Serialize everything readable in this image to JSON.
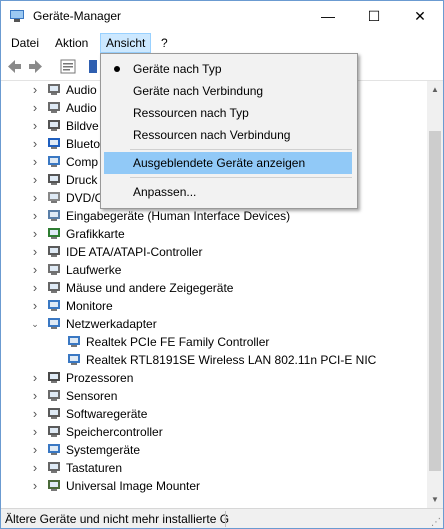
{
  "window": {
    "title": "Geräte-Manager",
    "controls": [
      "—",
      "☐",
      "✕"
    ]
  },
  "menubar": {
    "items": [
      "Datei",
      "Aktion",
      "Ansicht",
      "?"
    ],
    "open_index": 2
  },
  "dropdown": {
    "items": [
      {
        "label": "Geräte nach Typ",
        "checked": true
      },
      {
        "label": "Geräte nach Verbindung"
      },
      {
        "label": "Ressourcen nach Typ"
      },
      {
        "label": "Ressourcen nach Verbindung"
      },
      {
        "label": "Ausgeblendete Geräte anzeigen",
        "highlighted": true
      },
      {
        "label": "Anpassen..."
      }
    ]
  },
  "tree": {
    "nodes": [
      {
        "label": "Audio",
        "expanded": false,
        "icon": "speaker-icon"
      },
      {
        "label": "Audio",
        "expanded": false,
        "icon": "speaker-icon"
      },
      {
        "label": "Bildve",
        "expanded": false,
        "icon": "camera-icon"
      },
      {
        "label": "Blueto",
        "expanded": false,
        "icon": "bluetooth-icon"
      },
      {
        "label": "Comp",
        "expanded": false,
        "icon": "computer-icon"
      },
      {
        "label": "Druck",
        "expanded": false,
        "icon": "printer-icon"
      },
      {
        "label": "DVD/C",
        "expanded": false,
        "icon": "disc-drive-icon"
      },
      {
        "label": "Eingabegeräte (Human Interface Devices)",
        "expanded": false,
        "icon": "hid-icon"
      },
      {
        "label": "Grafikkarte",
        "expanded": false,
        "icon": "display-adapter-icon"
      },
      {
        "label": "IDE ATA/ATAPI-Controller",
        "expanded": false,
        "icon": "ide-controller-icon"
      },
      {
        "label": "Laufwerke",
        "expanded": false,
        "icon": "disk-drive-icon"
      },
      {
        "label": "Mäuse und andere Zeigegeräte",
        "expanded": false,
        "icon": "mouse-icon"
      },
      {
        "label": "Monitore",
        "expanded": false,
        "icon": "monitor-icon"
      },
      {
        "label": "Netzwerkadapter",
        "expanded": true,
        "icon": "network-icon"
      },
      {
        "label": "Realtek PCIe FE Family Controller",
        "child": true,
        "icon": "network-card-icon"
      },
      {
        "label": "Realtek RTL8191SE Wireless LAN 802.11n PCI-E NIC",
        "child": true,
        "icon": "network-card-icon"
      },
      {
        "label": "Prozessoren",
        "expanded": false,
        "icon": "processor-icon"
      },
      {
        "label": "Sensoren",
        "expanded": false,
        "icon": "sensor-icon"
      },
      {
        "label": "Softwaregeräte",
        "expanded": false,
        "icon": "software-device-icon"
      },
      {
        "label": "Speichercontroller",
        "expanded": false,
        "icon": "storage-controller-icon"
      },
      {
        "label": "Systemgeräte",
        "expanded": false,
        "icon": "system-device-icon"
      },
      {
        "label": "Tastaturen",
        "expanded": false,
        "icon": "keyboard-icon"
      },
      {
        "label": "Universal Image Mounter",
        "expanded": false,
        "icon": "image-mounter-icon"
      }
    ]
  },
  "statusbar": {
    "text": "Ältere Geräte und nicht mehr installierte G"
  },
  "colors": {
    "highlight": "#91c9f7",
    "menu_open": "#cce8ff",
    "menu_bg": "#f2f2f2"
  }
}
